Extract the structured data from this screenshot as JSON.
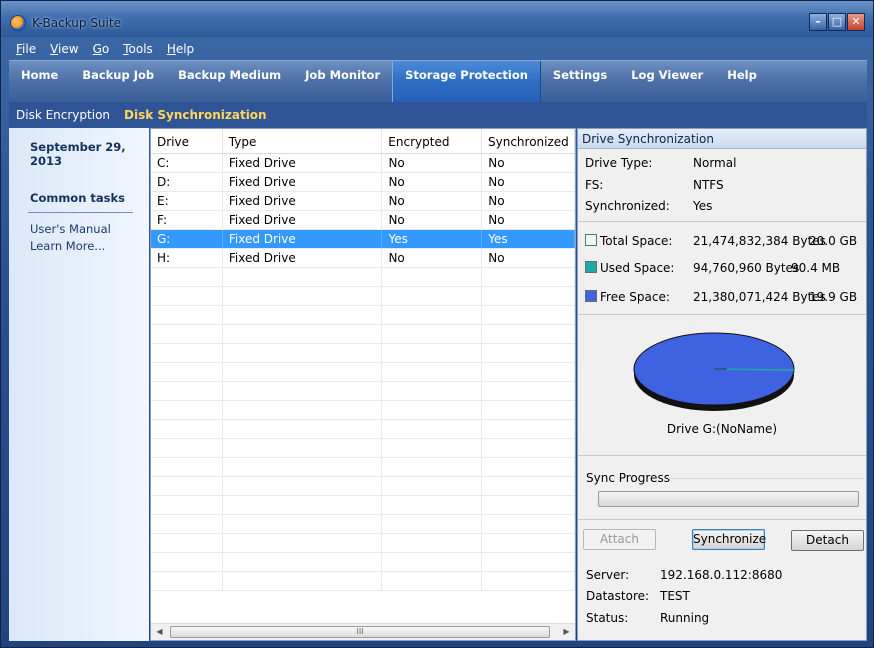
{
  "window": {
    "title": "K-Backup Suite"
  },
  "menu": [
    {
      "label": "File"
    },
    {
      "label": "View"
    },
    {
      "label": "Go"
    },
    {
      "label": "Tools"
    },
    {
      "label": "Help"
    }
  ],
  "nav": {
    "tabs": [
      {
        "label": "Home"
      },
      {
        "label": "Backup Job"
      },
      {
        "label": "Backup Medium"
      },
      {
        "label": "Job Monitor"
      },
      {
        "label": "Storage Protection"
      },
      {
        "label": "Settings"
      },
      {
        "label": "Log Viewer"
      },
      {
        "label": "Help"
      }
    ],
    "active": "Storage Protection"
  },
  "subnav": {
    "tabs": [
      {
        "label": "Disk Encryption"
      },
      {
        "label": "Disk Synchronization"
      }
    ],
    "active": "Disk Synchronization"
  },
  "sidebar": {
    "date": "September 29, 2013",
    "tasks_title": "Common tasks",
    "links": [
      {
        "label": "User's Manual"
      },
      {
        "label": "Learn More..."
      }
    ]
  },
  "drives": {
    "columns": [
      "Drive",
      "Type",
      "Encrypted",
      "Synchronized"
    ],
    "rows": [
      [
        "C:",
        "Fixed Drive",
        "No",
        "No"
      ],
      [
        "D:",
        "Fixed Drive",
        "No",
        "No"
      ],
      [
        "E:",
        "Fixed Drive",
        "No",
        "No"
      ],
      [
        "F:",
        "Fixed Drive",
        "No",
        "No"
      ],
      [
        "G:",
        "Fixed Drive",
        "Yes",
        "Yes"
      ],
      [
        "H:",
        "Fixed Drive",
        "No",
        "No"
      ]
    ],
    "selected_row": 4,
    "scroll_thumb_glyph": "III"
  },
  "sync": {
    "panel_title": "Drive Synchronization",
    "drive_type_label": "Drive Type:",
    "drive_type": "Normal",
    "fs_label": "FS:",
    "fs": "NTFS",
    "synced_label": "Synchronized:",
    "synced": "Yes",
    "total_label": "Total Space:",
    "total_bytes": "21,474,832,384 Bytes",
    "total_human": "20.0 GB",
    "used_label": "Used Space:",
    "used_bytes": "94,760,960 Bytes",
    "used_human": "90.4 MB",
    "free_label": "Free Space:",
    "free_bytes": "21,380,071,424 Bytes",
    "free_human": "19.9 GB",
    "colors": {
      "total": "#e8fbfb",
      "used": "#20a8a8",
      "free": "#3f63e0"
    },
    "pie_caption": "Drive G:(NoName)",
    "progress_label": "Sync Progress",
    "progress": 0,
    "buttons": {
      "attach": "Attach",
      "synchronize": "Synchronize",
      "detach": "Detach"
    },
    "server_label": "Server:",
    "server": "192.168.0.112:8680",
    "datastore_label": "Datastore:",
    "datastore": "TEST",
    "status_label": "Status:",
    "status": "Running"
  }
}
